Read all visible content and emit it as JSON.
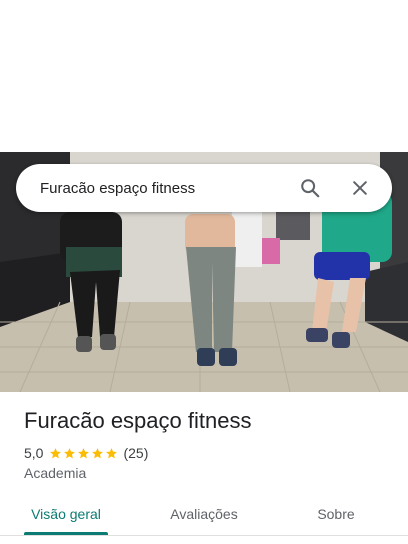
{
  "search": {
    "query": "Furacão espaço fitness",
    "search_icon": "search-icon",
    "close_icon": "close-icon"
  },
  "place": {
    "name": "Furacão espaço fitness",
    "rating": "5,0",
    "rating_value": 5.0,
    "stars_filled": 5,
    "reviews_count": "(25)",
    "category": "Academia"
  },
  "tabs": [
    {
      "label": "Visão geral",
      "active": true
    },
    {
      "label": "Avaliações",
      "active": false
    },
    {
      "label": "Sobre",
      "active": false
    }
  ],
  "colors": {
    "accent": "#0b7b73",
    "star": "#fbbc04"
  }
}
